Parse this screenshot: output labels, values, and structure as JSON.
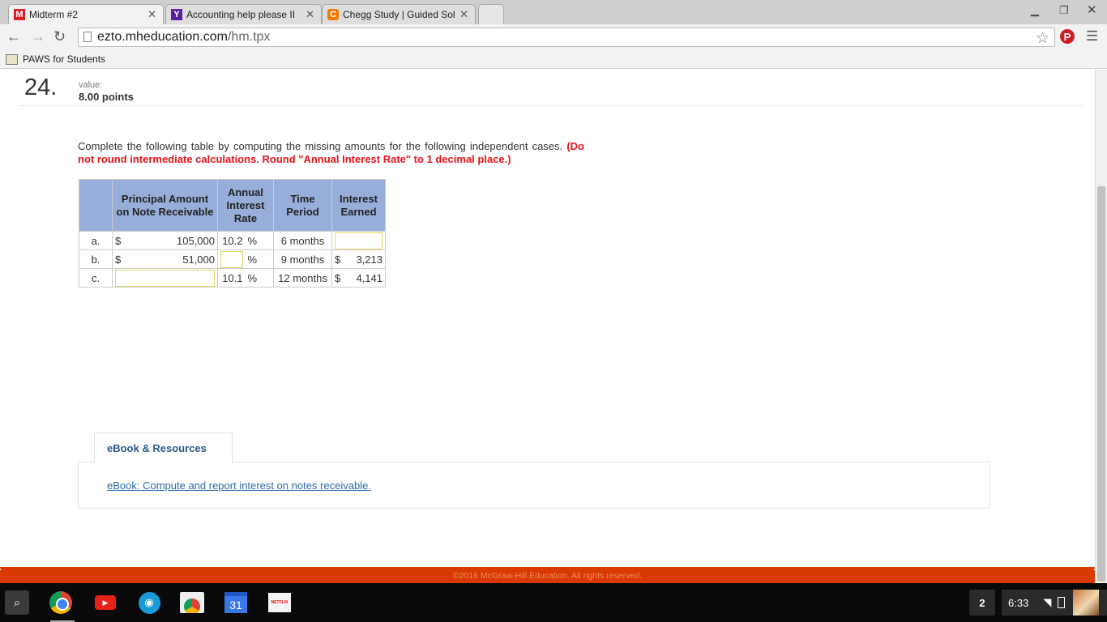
{
  "browser": {
    "tabs": [
      {
        "favicon": "M",
        "favicon_color": "#d81f26",
        "title": "Midterm #2"
      },
      {
        "favicon": "Y",
        "favicon_color": "#5a1fa0",
        "title": "Accounting help please II"
      },
      {
        "favicon": "C",
        "favicon_color": "#f07c00",
        "title": "Chegg Study | Guided Sol"
      }
    ],
    "close_glyph": "✕",
    "url_host": "ezto.mheducation.com",
    "url_path": "/hm.tpx",
    "bookmark": "PAWS for Students"
  },
  "question": {
    "number": "24.",
    "value_label": "value:",
    "points": "8.00 points",
    "instructions": "Complete the following table by computing the missing amounts for the following independent cases.",
    "note": "(Do not round intermediate calculations. Round \"Annual Interest Rate\" to 1 decimal place.)"
  },
  "table": {
    "headers": {
      "principal": "Principal Amount on Note Receivable",
      "rate": "Annual Interest Rate",
      "time": "Time Period",
      "interest": "Interest Earned"
    },
    "rows": [
      {
        "label": "a.",
        "principal_dollar": "$",
        "principal": "105,000",
        "rate": "10.2",
        "pct": "%",
        "time": "6 months",
        "interest_dollar": "",
        "interest": ""
      },
      {
        "label": "b.",
        "principal_dollar": "$",
        "principal": "51,000",
        "rate": "",
        "pct": "%",
        "time": "9 months",
        "interest_dollar": "$",
        "interest": "3,213"
      },
      {
        "label": "c.",
        "principal_dollar": "",
        "principal": "",
        "rate": "10.1",
        "pct": "%",
        "time": "12 months",
        "interest_dollar": "$",
        "interest": "4,141"
      }
    ]
  },
  "resources": {
    "tab_label": "eBook & Resources",
    "link": "eBook: Compute and report interest on notes receivable."
  },
  "footer": "©2016 McGraw-Hill Education. All rights reserved.",
  "shelf": {
    "calendar_day": "31",
    "netflix": "NETFLIX",
    "notification_count": "2",
    "time": "6:33"
  },
  "colors": {
    "header_blue": "#97aedb",
    "instruction_red": "#e8141b",
    "footer_orange": "#d83a00",
    "link_blue": "#2c6aa8"
  }
}
